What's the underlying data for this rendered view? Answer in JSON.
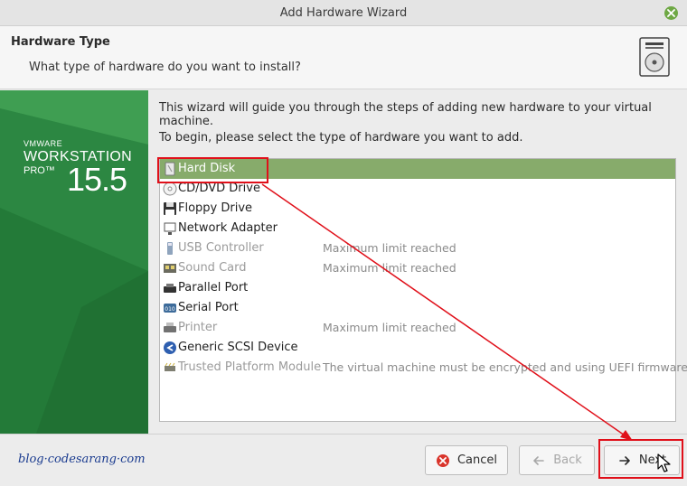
{
  "window": {
    "title": "Add Hardware Wizard"
  },
  "header": {
    "title": "Hardware Type",
    "subtitle": "What type of hardware do you want to install?"
  },
  "banner": {
    "vendor": "VMWARE",
    "product": "WORKSTATION",
    "edition": "PRO™",
    "version": "15.5"
  },
  "intro": {
    "line1": "This wizard will guide you through the steps of adding new hardware to your virtual machine.",
    "line2": "To begin, please select the type of hardware you want to add."
  },
  "hardware_list": [
    {
      "name": "Hard Disk",
      "note": "",
      "icon": "hard-disk-icon",
      "state": "selected"
    },
    {
      "name": "CD/DVD Drive",
      "note": "",
      "icon": "cd-dvd-icon",
      "state": "enabled"
    },
    {
      "name": "Floppy Drive",
      "note": "",
      "icon": "floppy-icon",
      "state": "enabled"
    },
    {
      "name": "Network Adapter",
      "note": "",
      "icon": "network-adapter-icon",
      "state": "enabled"
    },
    {
      "name": "USB Controller",
      "note": "Maximum limit reached",
      "icon": "usb-icon",
      "state": "disabled"
    },
    {
      "name": "Sound Card",
      "note": "Maximum limit reached",
      "icon": "sound-card-icon",
      "state": "disabled"
    },
    {
      "name": "Parallel Port",
      "note": "",
      "icon": "parallel-port-icon",
      "state": "enabled"
    },
    {
      "name": "Serial Port",
      "note": "",
      "icon": "serial-port-icon",
      "state": "enabled"
    },
    {
      "name": "Printer",
      "note": "Maximum limit reached",
      "icon": "printer-icon",
      "state": "disabled"
    },
    {
      "name": "Generic SCSI Device",
      "note": "",
      "icon": "scsi-icon",
      "state": "enabled"
    },
    {
      "name": "Trusted Platform Module",
      "note": "The virtual machine must be encrypted and using UEFI firmware.",
      "icon": "tpm-icon",
      "state": "disabled"
    }
  ],
  "footer": {
    "watermark": "blog·codesarang·com",
    "cancel_label": "Cancel",
    "back_label": "Back",
    "next_label": "Next"
  },
  "colors": {
    "banner_green": "#2f8d44",
    "selection_green": "#87ab6b",
    "annotation_red": "#e0101a"
  }
}
